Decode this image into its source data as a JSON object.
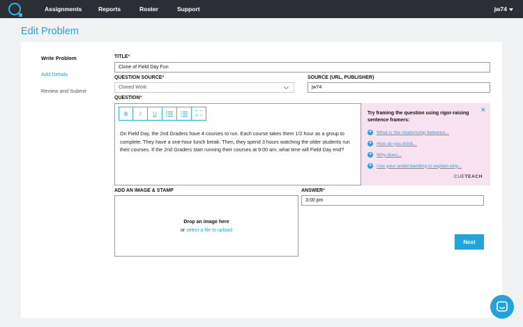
{
  "nav": {
    "items": [
      "Assignments",
      "Reports",
      "Roster",
      "Support"
    ],
    "user": "jw74"
  },
  "page": {
    "title": "Edit Problem"
  },
  "steps": [
    {
      "label": "Write Problem"
    },
    {
      "label": "Add Details"
    },
    {
      "label": "Review and Submit"
    }
  ],
  "form": {
    "title_label": "TITLE",
    "title_value": "Clone of Field Day Fun",
    "question_source_label": "QUESTION SOURCE",
    "question_source_value": "Cloned Work",
    "source_label": "SOURCE (URL, PUBLISHER)",
    "source_value": "jw74",
    "question_label": "QUESTION",
    "question_text": "On Field Day, the 2nd Graders have 4 courses to run. Each course takes them 1/2 hour as a group to complete. They have a one-hour lunch break. Then, they spend 3 hours watching the older students run their courses. If the 2nd Graders start running their courses at 9:00 am, what time will Field Day end?",
    "image_label": "ADD AN IMAGE & STAMP",
    "drop_text": "Drop an image here",
    "drop_or": "or",
    "drop_link": "select a file to upload",
    "answer_label": "ANSWER",
    "answer_value": "3:00 pm",
    "next_label": "Next",
    "required_mark": "*"
  },
  "toolbar": {
    "bold": "B",
    "italic": "I",
    "underline": "U",
    "math_top": "+ −",
    "math_bottom": "× ÷"
  },
  "tips": {
    "heading": "Try framing the question using rigor-raising sentence framers:",
    "close": "×",
    "items": [
      "What is the relationship between...",
      "How do you think...",
      "Why does...",
      "Use your understanding to explain why..."
    ],
    "brand_cue": "CUE",
    "brand_teach": "TEACH"
  },
  "colors": {
    "accent": "#22a3d9",
    "topbar": "#2b2f35",
    "tips_bg": "#f7e3ef",
    "required": "#d0021b"
  }
}
